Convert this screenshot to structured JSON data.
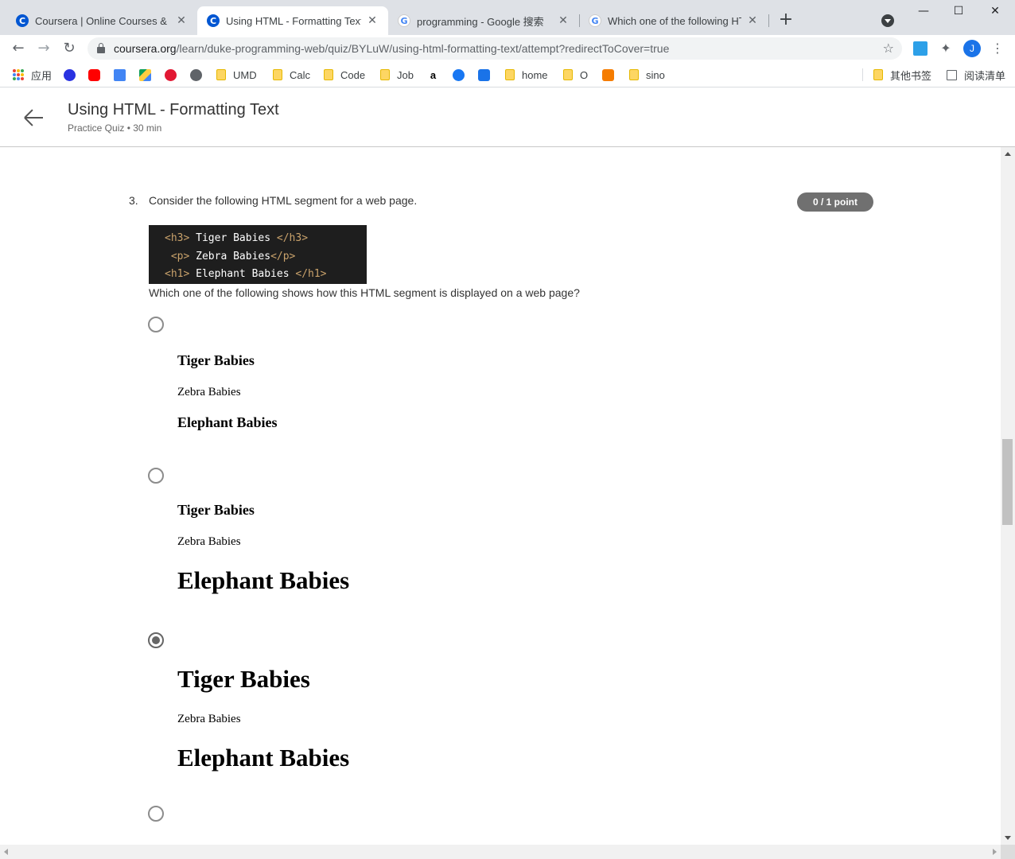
{
  "browser": {
    "tabs": [
      {
        "title": "Coursera | Online Courses & C",
        "favicon": "coursera-icon"
      },
      {
        "title": "Using HTML - Formatting Text",
        "favicon": "coursera-icon"
      },
      {
        "title": "programming - Google 搜索",
        "favicon": "google-icon"
      },
      {
        "title": "Which one of the following HT",
        "favicon": "google-icon"
      }
    ],
    "active_tab": 1,
    "url_host": "coursera.org",
    "url_path": "/learn/duke-programming-web/quiz/BYLuW/using-html-formatting-text/attempt?redirectToCover=true",
    "profile_initial": "J"
  },
  "bookmarks": [
    {
      "label": "应用",
      "icon": "apps-icon"
    },
    {
      "label": "",
      "icon": "baidu-icon"
    },
    {
      "label": "",
      "icon": "youtube-icon"
    },
    {
      "label": "",
      "icon": "translate-icon"
    },
    {
      "label": "",
      "icon": "drive-icon"
    },
    {
      "label": "",
      "icon": "umd-icon"
    },
    {
      "label": "",
      "icon": "globe-icon"
    },
    {
      "label": "UMD",
      "icon": "folder-icon"
    },
    {
      "label": "Calc",
      "icon": "folder-icon"
    },
    {
      "label": "Code",
      "icon": "folder-icon"
    },
    {
      "label": "Job",
      "icon": "folder-icon"
    },
    {
      "label": "",
      "icon": "amazon-icon"
    },
    {
      "label": "",
      "icon": "facebook-icon"
    },
    {
      "label": "",
      "icon": "dict-icon"
    },
    {
      "label": "home",
      "icon": "folder-icon"
    },
    {
      "label": "O",
      "icon": "folder-icon"
    },
    {
      "label": "",
      "icon": "c-icon"
    },
    {
      "label": "sino",
      "icon": "folder-icon"
    },
    {
      "label": "其他书签",
      "icon": "folder-icon"
    },
    {
      "label": "阅读清单",
      "icon": "reading-list-icon"
    }
  ],
  "header": {
    "title": "Using HTML - Formatting Text",
    "subtitle": "Practice Quiz • 30 min"
  },
  "question": {
    "number": "3.",
    "text": "Consider the following HTML segment for a web page.",
    "points": "0 / 1 point",
    "code_lines": [
      {
        "open": "<h3>",
        "text": " Tiger Babies ",
        "close": "</h3>",
        "indent": ""
      },
      {
        "open": "<p>",
        "text": " Zebra Babies",
        "close": "</p>",
        "indent": " "
      },
      {
        "open": "<h1>",
        "text": " Elephant Babies ",
        "close": "</h1>",
        "indent": ""
      }
    ],
    "prompt": "Which one of the following shows how this HTML segment is displayed on a web page?",
    "selected_option": 2,
    "options": [
      {
        "line1": "Tiger Babies",
        "line2": "Zebra Babies",
        "line3": "Elephant Babies"
      },
      {
        "line1": "Tiger Babies",
        "line2": "Zebra Babies",
        "line3": "Elephant Babies"
      },
      {
        "line1": "Tiger Babies",
        "line2": "Zebra Babies",
        "line3": "Elephant Babies"
      }
    ]
  },
  "colors": {
    "coursera_blue": "#0056d2",
    "points_badge": "#707070",
    "code_bg": "#1e1e1e",
    "code_tag": "#c9a26b"
  }
}
